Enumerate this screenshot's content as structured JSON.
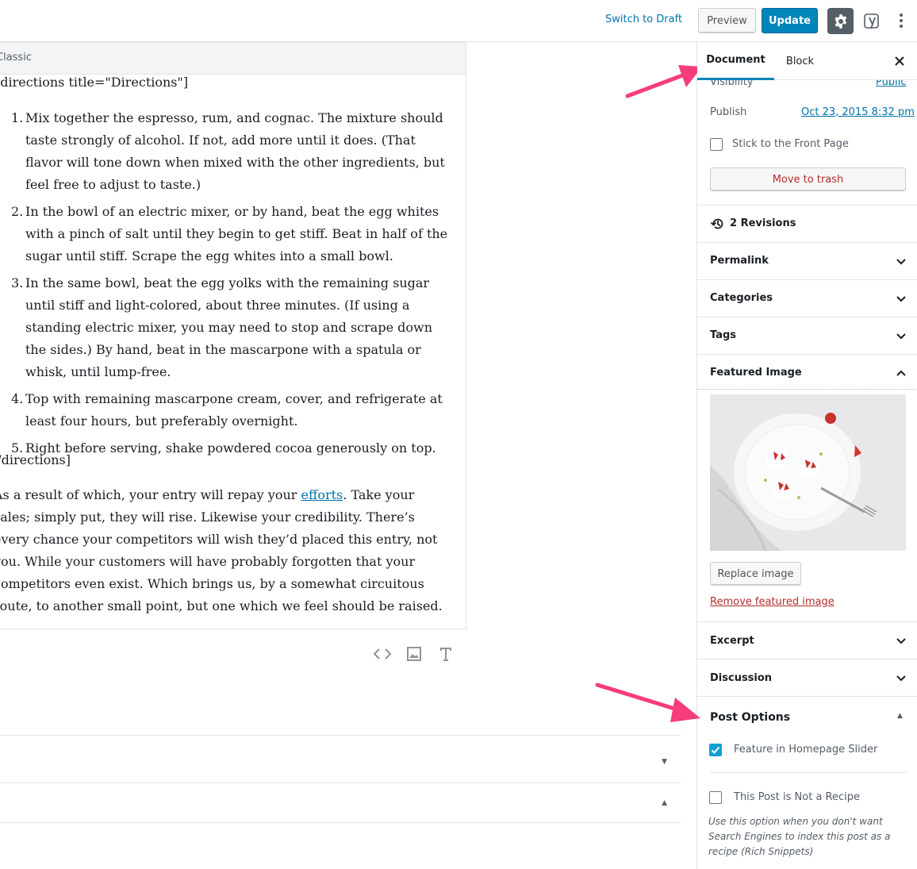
{
  "topbar": {
    "switch_to_draft": "Switch to Draft",
    "preview": "Preview",
    "update": "Update",
    "settings_icon": "gear-icon",
    "yoast_icon": "yoast-icon",
    "more_icon": "vertical-ellipsis-icon"
  },
  "editor": {
    "block_label": "Classic",
    "shortcode_open": "[directions title=\"Directions\"]",
    "steps": [
      {
        "num": "1.",
        "text": "Mix together the espresso, rum, and cognac. The mixture should taste strongly of alcohol. If not, add more until it does. (That flavor will tone down when mixed with the other ingredients, but feel free to adjust to taste.)"
      },
      {
        "num": "2.",
        "text": "In the bowl of an electric mixer, or by hand, beat the egg whites with a pinch of salt until they begin to get stiff. Beat in half of the sugar until stiff. Scrape the egg whites into a small bowl."
      },
      {
        "num": "3.",
        "text": "In the same bowl, beat the egg yolks with the remaining sugar until stiff and light-colored, about three minutes. (If using a standing electric mixer, you may need to stop and scrape down the sides.) By hand, beat in the mascarpone with a spatula or whisk, until lump-free."
      },
      {
        "num": "4.",
        "text": "Top with remaining mascarpone cream, cover, and refrigerate at least four hours, but preferably overnight."
      },
      {
        "num": "5.",
        "text": "Right before serving, shake powdered cocoa generously on top."
      }
    ],
    "shortcode_close": "[/directions]",
    "paragraph_before_link": "As a result of which, your entry will repay your ",
    "paragraph_link": "efforts",
    "paragraph_after_link": ". Take your sales; simply put, they will rise. Likewise your credibility. There’s every chance your competitors will wish they’d placed this entry, not you. While your customers will have probably forgotten that your competitors even exist. Which brings us, by a somewhat circuitous route, to another small point, but one which we feel should be raised.",
    "tool_icons": [
      "code-icon",
      "image-icon",
      "text-icon"
    ],
    "meta_box_carets": [
      "▼",
      "▲"
    ]
  },
  "sidebar": {
    "tab_document": "Document",
    "tab_block": "Block",
    "close_icon": "close-icon",
    "visibility_label": "Visibility",
    "visibility_value": "Public",
    "publish_label": "Publish",
    "publish_value": "Oct 23, 2015 8:32 pm",
    "stick_front_page": "Stick to the Front Page",
    "move_to_trash": "Move to trash",
    "revisions": "2 Revisions",
    "panels": {
      "permalink": "Permalink",
      "categories": "Categories",
      "tags": "Tags",
      "featured_image": "Featured Image",
      "excerpt": "Excerpt",
      "discussion": "Discussion",
      "post_options": "Post Options"
    },
    "replace_image": "Replace image",
    "remove_featured_image": "Remove featured image",
    "feature_homepage_slider": "Feature in Homepage Slider",
    "feature_homepage_slider_checked": true,
    "not_a_recipe": "This Post is Not a Recipe",
    "not_a_recipe_checked": false,
    "not_a_recipe_help": "Use this option when you don't want Search Engines to index this post as a recipe (Rich Snippets)"
  },
  "colors": {
    "accent": "#0085ba",
    "link": "#0073aa",
    "danger": "#b32d2e",
    "arrow": "#f53d7a"
  }
}
